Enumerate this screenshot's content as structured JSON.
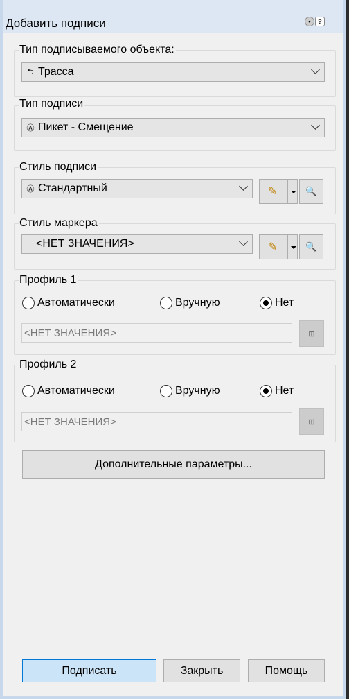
{
  "window": {
    "title": "Добавить подписи"
  },
  "object_type": {
    "label": "Тип подписываемого объекта:",
    "value": "Трасса",
    "icon": "alignment-icon"
  },
  "label_type": {
    "label": "Тип подписи",
    "value": "Пикет - Смещение",
    "icon": "label-icon"
  },
  "label_style": {
    "label": "Стиль подписи",
    "value": "Стандартный",
    "icon": "label-style-icon"
  },
  "marker_style": {
    "label": "Стиль маркера",
    "value": "<НЕТ ЗНАЧЕНИЯ>"
  },
  "profile1": {
    "label": "Профиль 1",
    "options": [
      "Автоматически",
      "Вручную",
      "Нет"
    ],
    "selected": "Нет",
    "field_value": "<НЕТ ЗНАЧЕНИЯ>"
  },
  "profile2": {
    "label": "Профиль 2",
    "options": [
      "Автоматически",
      "Вручную",
      "Нет"
    ],
    "selected": "Нет",
    "field_value": "<НЕТ ЗНАЧЕНИЯ>"
  },
  "buttons": {
    "more": "Дополнительные параметры...",
    "label": "Подписать",
    "close": "Закрыть",
    "help": "Помощь"
  }
}
